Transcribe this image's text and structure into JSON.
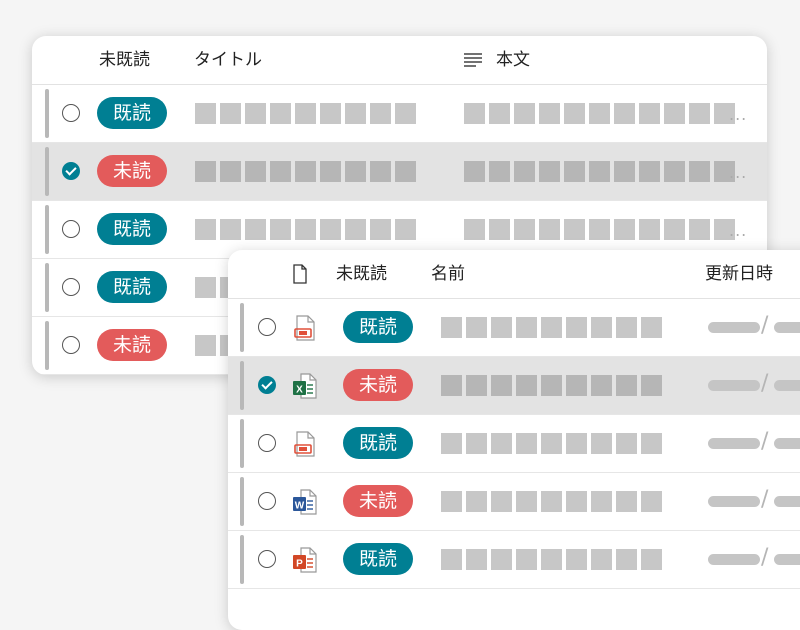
{
  "mail_list": {
    "headers": {
      "unread": "未既読",
      "title": "タイトル",
      "body": "本文"
    },
    "body_header_icon": "text-lines-icon",
    "rows": [
      {
        "status": "既読",
        "state": "read",
        "checked": false
      },
      {
        "status": "未読",
        "state": "unread",
        "checked": true
      },
      {
        "status": "既読",
        "state": "read",
        "checked": false
      },
      {
        "status": "既読",
        "state": "read",
        "checked": false
      },
      {
        "status": "未読",
        "state": "unread",
        "checked": false
      }
    ],
    "truncation": "..."
  },
  "file_list": {
    "headers": {
      "unread": "未既読",
      "name": "名前",
      "updated": "更新日時"
    },
    "type_header_icon": "document-icon",
    "rows": [
      {
        "status": "既読",
        "state": "read",
        "checked": false,
        "file_icon": "acrobat-file-icon"
      },
      {
        "status": "未読",
        "state": "unread",
        "checked": true,
        "file_icon": "excel-file-icon",
        "icon_letter": "X"
      },
      {
        "status": "既読",
        "state": "read",
        "checked": false,
        "file_icon": "acrobat-file-icon"
      },
      {
        "status": "未読",
        "state": "unread",
        "checked": false,
        "file_icon": "word-file-icon",
        "icon_letter": "W"
      },
      {
        "status": "既読",
        "state": "read",
        "checked": false,
        "file_icon": "powerpoint-file-icon",
        "icon_letter": "P"
      }
    ],
    "date_separator": "/"
  },
  "colors": {
    "read": "#007f93",
    "unread": "#e35b5b",
    "excel": "#1e7145",
    "word": "#2b579a",
    "powerpoint": "#d24726",
    "acrobat": "#e0503a",
    "placeholder": "#c7c7c7"
  }
}
